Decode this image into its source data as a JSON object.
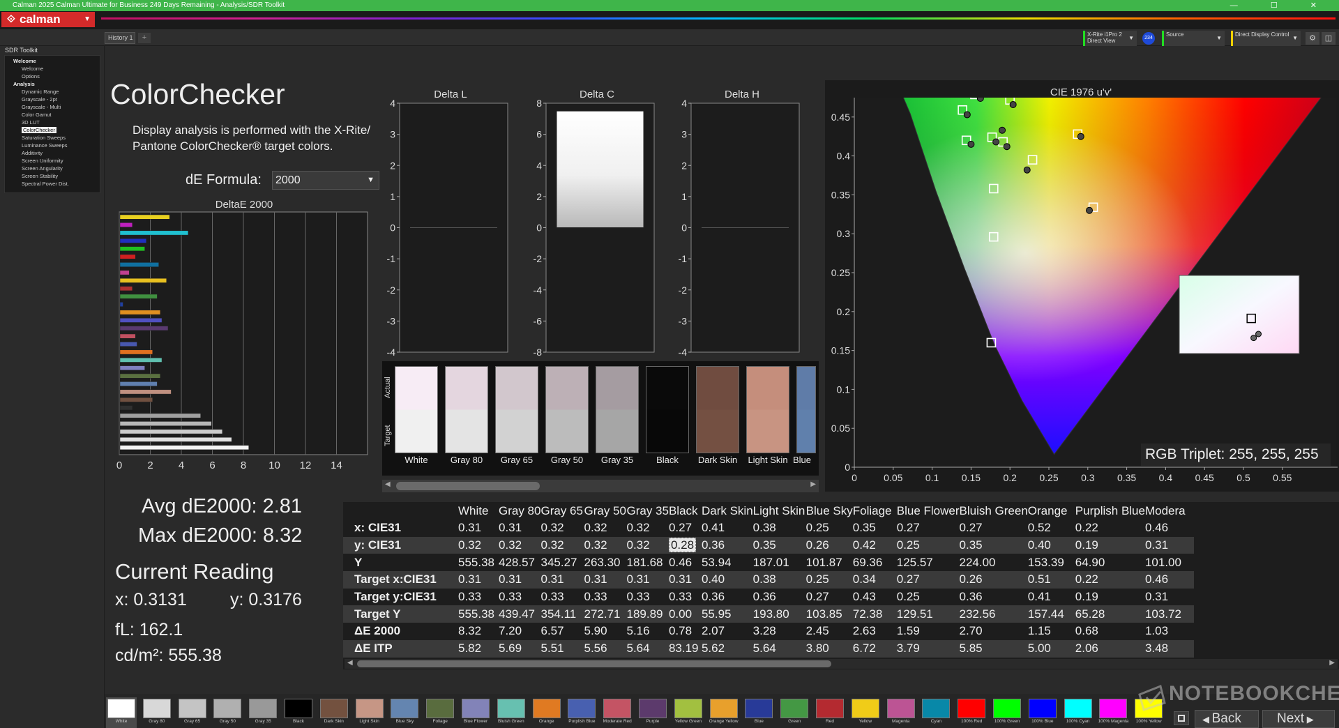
{
  "window": {
    "title": "Calman 2025 Calman Ultimate for Business 249 Days Remaining  - Analysis/SDR Toolkit",
    "controls": "— ☐ ✕"
  },
  "app": {
    "logo_text": "calman",
    "logo_icon": "calman-icon"
  },
  "tabs": [
    {
      "label": "History 1"
    }
  ],
  "devices": {
    "meter": {
      "line1": "X-Rite i1Pro 2",
      "line2": "Direct View"
    },
    "meter_badge": "234",
    "source": {
      "label": "Source"
    },
    "display": {
      "label": "Direct Display Control"
    }
  },
  "sidebar": {
    "workflow": "SDR Toolkit",
    "items": [
      {
        "label": "Welcome",
        "kind": "section"
      },
      {
        "label": "Welcome",
        "kind": "item"
      },
      {
        "label": "Options",
        "kind": "item"
      },
      {
        "label": "Analysis",
        "kind": "section"
      },
      {
        "label": "Dynamic Range",
        "kind": "item"
      },
      {
        "label": "Grayscale - 2pt",
        "kind": "item"
      },
      {
        "label": "Grayscale - Multi",
        "kind": "item"
      },
      {
        "label": "Color Gamut",
        "kind": "item"
      },
      {
        "label": "3D LUT",
        "kind": "item"
      },
      {
        "label": "ColorChecker",
        "kind": "selected"
      },
      {
        "label": "Saturation Sweeps",
        "kind": "item"
      },
      {
        "label": "Luminance Sweeps",
        "kind": "item"
      },
      {
        "label": "Additivity",
        "kind": "item"
      },
      {
        "label": "Screen Uniformity",
        "kind": "item"
      },
      {
        "label": "Screen Angularity",
        "kind": "item"
      },
      {
        "label": "Screen Stability",
        "kind": "item"
      },
      {
        "label": "Spectral Power Dist.",
        "kind": "item"
      }
    ]
  },
  "main": {
    "title": "ColorChecker",
    "description_line1": "Display analysis is performed with the X-Rite/",
    "description_line2": "Pantone ColorChecker® target colors.",
    "de_formula_label": "dE Formula:",
    "de_formula_value": "2000",
    "avg": "Avg dE2000: 2.81",
    "max": "Max dE2000: 8.32",
    "current_reading_title": "Current Reading",
    "current_x": "x: 0.3131",
    "current_y": "y: 0.3176",
    "current_fl": "fL: 162.1",
    "current_cdm2": "cd/m²: 555.38",
    "rgb_triplet": "RGB Triplet: 255, 255, 255"
  },
  "swatches": {
    "actual_label": "Actual",
    "target_label": "Target",
    "items": [
      {
        "name": "White",
        "actual": "#f7ecf5",
        "target": "#f0f0f0"
      },
      {
        "name": "Gray 80",
        "actual": "#e4d6df",
        "target": "#e4e4e4"
      },
      {
        "name": "Gray 65",
        "actual": "#d2c7cd",
        "target": "#d2d2d2"
      },
      {
        "name": "Gray 50",
        "actual": "#bdb0b6",
        "target": "#bcbcbc"
      },
      {
        "name": "Gray 35",
        "actual": "#a59ca1",
        "target": "#a6a6a6"
      },
      {
        "name": "Black",
        "actual": "#0a0a0a",
        "target": "#080808"
      },
      {
        "name": "Dark Skin",
        "actual": "#704c40",
        "target": "#745042"
      },
      {
        "name": "Light Skin",
        "actual": "#c58e7c",
        "target": "#c89482"
      },
      {
        "name": "Blue",
        "actual": "#5f7ca8",
        "target": "#6080ac"
      }
    ]
  },
  "bottom_strip": [
    {
      "label": "White",
      "color": "#ffffff"
    },
    {
      "label": "Gray 80",
      "color": "#d8d8d8"
    },
    {
      "label": "Gray 65",
      "color": "#c4c4c4"
    },
    {
      "label": "Gray 50",
      "color": "#b0b0b0"
    },
    {
      "label": "Gray 35",
      "color": "#999999"
    },
    {
      "label": "Black",
      "color": "#000000"
    },
    {
      "label": "Dark Skin",
      "color": "#73513f"
    },
    {
      "label": "Light Skin",
      "color": "#c69685"
    },
    {
      "label": "Blue Sky",
      "color": "#6485b0"
    },
    {
      "label": "Foliage",
      "color": "#596c3e"
    },
    {
      "label": "Blue Flower",
      "color": "#8283b8"
    },
    {
      "label": "Bluish Green",
      "color": "#67c0b0"
    },
    {
      "label": "Orange",
      "color": "#e07a22"
    },
    {
      "label": "Purplish Blue",
      "color": "#4860b0"
    },
    {
      "label": "Moderate Red",
      "color": "#c45464"
    },
    {
      "label": "Purple",
      "color": "#5c3a6c"
    },
    {
      "label": "Yellow Green",
      "color": "#a2c040"
    },
    {
      "label": "Orange Yellow",
      "color": "#e8a02c"
    },
    {
      "label": "Blue",
      "color": "#283a98"
    },
    {
      "label": "Green",
      "color": "#449844"
    },
    {
      "label": "Red",
      "color": "#b42a30"
    },
    {
      "label": "Yellow",
      "color": "#f0cc18"
    },
    {
      "label": "Magenta",
      "color": "#bc5494"
    },
    {
      "label": "Cyan",
      "color": "#0888a8"
    },
    {
      "label": "100% Red",
      "color": "#ff0000"
    },
    {
      "label": "100% Green",
      "color": "#00ff00"
    },
    {
      "label": "100% Blue",
      "color": "#0000ff"
    },
    {
      "label": "100% Cyan",
      "color": "#00ffff"
    },
    {
      "label": "100% Magenta",
      "color": "#ff00ff"
    },
    {
      "label": "100% Yellow",
      "color": "#ffff00"
    }
  ],
  "nav": {
    "back": "Back",
    "next": "Next"
  },
  "watermark": "NOTEBOOKCHECK",
  "table": {
    "columns": [
      "White",
      "Gray 80",
      "Gray 65",
      "Gray 50",
      "Gray 35",
      "Black",
      "Dark Skin",
      "Light Skin",
      "Blue Sky",
      "Foliage",
      "Blue Flower",
      "Bluish Green",
      "Orange",
      "Purplish Blue",
      "Modera"
    ],
    "rows": [
      {
        "label": "x: CIE31",
        "values": [
          "0.31",
          "0.31",
          "0.32",
          "0.32",
          "0.32",
          "0.27",
          "0.41",
          "0.38",
          "0.25",
          "0.35",
          "0.27",
          "0.27",
          "0.52",
          "0.22",
          "0.46"
        ]
      },
      {
        "label": "y: CIE31",
        "values": [
          "0.32",
          "0.32",
          "0.32",
          "0.32",
          "0.32",
          "0.28",
          "0.36",
          "0.35",
          "0.26",
          "0.42",
          "0.25",
          "0.35",
          "0.40",
          "0.19",
          "0.31"
        ]
      },
      {
        "label": "Y",
        "values": [
          "555.38",
          "428.57",
          "345.27",
          "263.30",
          "181.68",
          "0.46",
          "53.94",
          "187.01",
          "101.87",
          "69.36",
          "125.57",
          "224.00",
          "153.39",
          "64.90",
          "101.00"
        ]
      },
      {
        "label": "Target x:CIE31",
        "values": [
          "0.31",
          "0.31",
          "0.31",
          "0.31",
          "0.31",
          "0.31",
          "0.40",
          "0.38",
          "0.25",
          "0.34",
          "0.27",
          "0.26",
          "0.51",
          "0.22",
          "0.46"
        ]
      },
      {
        "label": "Target y:CIE31",
        "values": [
          "0.33",
          "0.33",
          "0.33",
          "0.33",
          "0.33",
          "0.33",
          "0.36",
          "0.36",
          "0.27",
          "0.43",
          "0.25",
          "0.36",
          "0.41",
          "0.19",
          "0.31"
        ]
      },
      {
        "label": "Target Y",
        "values": [
          "555.38",
          "439.47",
          "354.11",
          "272.71",
          "189.89",
          "0.00",
          "55.95",
          "193.80",
          "103.85",
          "72.38",
          "129.51",
          "232.56",
          "157.44",
          "65.28",
          "103.72"
        ]
      },
      {
        "label": "ΔE 2000",
        "values": [
          "8.32",
          "7.20",
          "6.57",
          "5.90",
          "5.16",
          "0.78",
          "2.07",
          "3.28",
          "2.45",
          "2.63",
          "1.59",
          "2.70",
          "1.15",
          "0.68",
          "1.03"
        ]
      },
      {
        "label": "ΔE ITP",
        "values": [
          "5.82",
          "5.69",
          "5.51",
          "5.56",
          "5.64",
          "83.19",
          "5.62",
          "5.64",
          "3.80",
          "6.72",
          "3.79",
          "5.85",
          "5.00",
          "2.06",
          "3.48"
        ]
      }
    ]
  },
  "chart_data": [
    {
      "type": "bar",
      "orientation": "horizontal",
      "title": "DeltaE 2000",
      "xlim": [
        0,
        16
      ],
      "xticks": [
        "0",
        "2",
        "4",
        "6",
        "8",
        "10",
        "12",
        "14"
      ],
      "bars": [
        {
          "value": 3.2,
          "color": "#e8d020"
        },
        {
          "value": 0.8,
          "color": "#c020c0"
        },
        {
          "value": 4.4,
          "color": "#20c0d0"
        },
        {
          "value": 1.7,
          "color": "#2030c0"
        },
        {
          "value": 1.6,
          "color": "#20c020"
        },
        {
          "value": 1.0,
          "color": "#d02020"
        },
        {
          "value": 2.5,
          "color": "#1070a0"
        },
        {
          "value": 0.6,
          "color": "#c04090"
        },
        {
          "value": 3.0,
          "color": "#e8c020"
        },
        {
          "value": 0.8,
          "color": "#b03030"
        },
        {
          "value": 2.4,
          "color": "#409040"
        },
        {
          "value": 0.2,
          "color": "#2040a0"
        },
        {
          "value": 2.6,
          "color": "#e09020"
        },
        {
          "value": 2.7,
          "color": "#5050c0"
        },
        {
          "value": 3.1,
          "color": "#5a3a70"
        },
        {
          "value": 1.0,
          "color": "#c05060"
        },
        {
          "value": 1.1,
          "color": "#4858b0"
        },
        {
          "value": 2.1,
          "color": "#e07020"
        },
        {
          "value": 2.7,
          "color": "#60c0b0"
        },
        {
          "value": 1.6,
          "color": "#8080c0"
        },
        {
          "value": 2.6,
          "color": "#5a7040"
        },
        {
          "value": 2.4,
          "color": "#6080b0"
        },
        {
          "value": 3.3,
          "color": "#c09080"
        },
        {
          "value": 2.1,
          "color": "#705040"
        },
        {
          "value": 0.8,
          "color": "#303030"
        },
        {
          "value": 5.2,
          "color": "#a0a0a0"
        },
        {
          "value": 5.9,
          "color": "#b8b8b8"
        },
        {
          "value": 6.6,
          "color": "#cccccc"
        },
        {
          "value": 7.2,
          "color": "#e0e0e0"
        },
        {
          "value": 8.3,
          "color": "#f4f4f4"
        }
      ]
    },
    {
      "type": "bar",
      "title": "Delta L",
      "ylim": [
        -4,
        4
      ],
      "yticks": [
        "4",
        "3",
        "2",
        "1",
        "0",
        "-1",
        "-2",
        "-3",
        "-4"
      ],
      "values": [
        0
      ]
    },
    {
      "type": "bar",
      "title": "Delta C",
      "ylim": [
        -8,
        8
      ],
      "yticks": [
        "8",
        "6",
        "4",
        "2",
        "0",
        "-2",
        "-4",
        "-6",
        "-8"
      ],
      "values": [
        7.5
      ]
    },
    {
      "type": "bar",
      "title": "Delta H",
      "ylim": [
        -4,
        4
      ],
      "yticks": [
        "4",
        "3",
        "2",
        "1",
        "0",
        "-1",
        "-2",
        "-3",
        "-4"
      ],
      "values": [
        0
      ]
    },
    {
      "type": "scatter",
      "title": "CIE 1976 u'v'",
      "xlim": [
        0,
        0.6
      ],
      "ylim": [
        0,
        0.6
      ],
      "xticks": [
        "0",
        "0.05",
        "0.1",
        "0.15",
        "0.2",
        "0.25",
        "0.3",
        "0.35",
        "0.4",
        "0.45",
        "0.5",
        "0.55"
      ],
      "yticks": [
        "0",
        "0.05",
        "0.1",
        "0.15",
        "0.2",
        "0.25",
        "0.3",
        "0.35",
        "0.4",
        "0.45",
        "0.5",
        "0.55"
      ],
      "targets": [
        [
          0.127,
          0.565
        ],
        [
          0.148,
          0.538
        ],
        [
          0.173,
          0.518
        ],
        [
          0.205,
          0.527
        ],
        [
          0.2,
          0.472
        ],
        [
          0.155,
          0.479
        ],
        [
          0.139,
          0.459
        ],
        [
          0.144,
          0.42
        ],
        [
          0.177,
          0.424
        ],
        [
          0.191,
          0.418
        ],
        [
          0.229,
          0.395
        ],
        [
          0.236,
          0.497
        ],
        [
          0.245,
          0.505
        ],
        [
          0.256,
          0.542
        ],
        [
          0.29,
          0.538
        ],
        [
          0.319,
          0.487
        ],
        [
          0.375,
          0.5
        ],
        [
          0.451,
          0.525
        ],
        [
          0.287,
          0.428
        ],
        [
          0.307,
          0.334
        ],
        [
          0.179,
          0.358
        ],
        [
          0.179,
          0.296
        ],
        [
          0.176,
          0.16
        ],
        [
          0.189,
          0.556
        ],
        [
          0.175,
          0.55
        ],
        [
          0.222,
          0.55
        ]
      ],
      "measured": [
        [
          0.133,
          0.561
        ],
        [
          0.155,
          0.534
        ],
        [
          0.178,
          0.514
        ],
        [
          0.211,
          0.522
        ],
        [
          0.204,
          0.466
        ],
        [
          0.162,
          0.474
        ],
        [
          0.145,
          0.453
        ],
        [
          0.15,
          0.415
        ],
        [
          0.182,
          0.418
        ],
        [
          0.196,
          0.412
        ],
        [
          0.222,
          0.382
        ],
        [
          0.243,
          0.492
        ],
        [
          0.251,
          0.501
        ],
        [
          0.262,
          0.538
        ],
        [
          0.297,
          0.535
        ],
        [
          0.325,
          0.483
        ],
        [
          0.38,
          0.496
        ],
        [
          0.455,
          0.521
        ],
        [
          0.291,
          0.425
        ],
        [
          0.302,
          0.33
        ],
        [
          0.19,
          0.433
        ],
        [
          0.199,
          0.557
        ],
        [
          0.184,
          0.546
        ],
        [
          0.228,
          0.545
        ]
      ],
      "inset_target": [
        0.6,
        0.55
      ],
      "inset_measured": [
        [
          0.66,
          0.75
        ],
        [
          0.62,
          0.8
        ]
      ]
    }
  ]
}
